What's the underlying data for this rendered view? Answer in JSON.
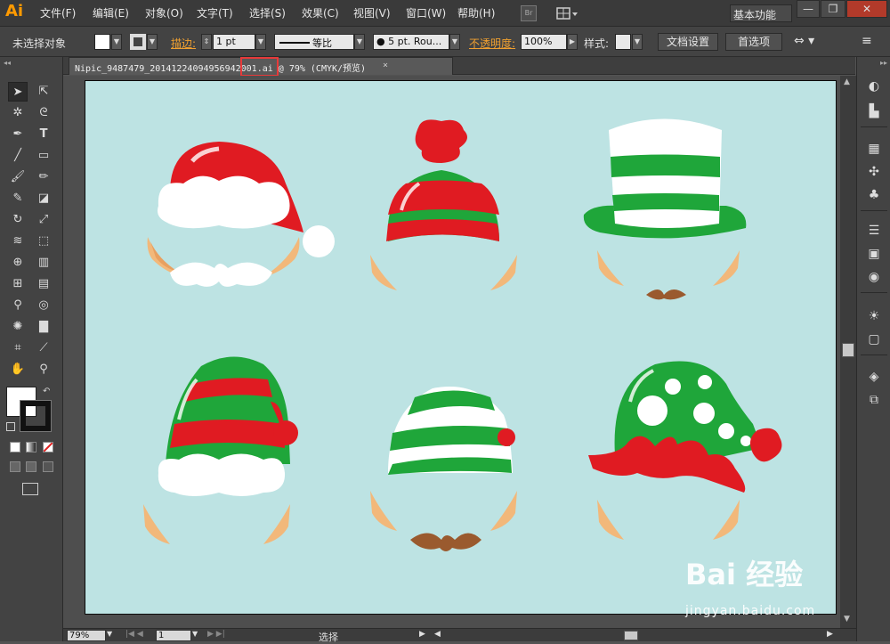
{
  "app": {
    "logo": "Ai",
    "menu": [
      "文件(F)",
      "编辑(E)",
      "对象(O)",
      "文字(T)",
      "选择(S)",
      "效果(C)",
      "视图(V)",
      "窗口(W)",
      "帮助(H)"
    ],
    "bridge_label": "Br",
    "workspace": "基本功能",
    "window_buttons": [
      "—",
      "❐",
      "✕"
    ]
  },
  "control": {
    "selection_state": "未选择对象",
    "stroke_label": "描边:",
    "stroke_weight": "1 pt",
    "brush_profile": "等比",
    "brush_def": "● 5 pt. Rou...",
    "opacity_label": "不透明度:",
    "opacity_value": "100%",
    "style_label": "样式:",
    "doc_setup_button": "文档设置",
    "preferences_button": "首选项"
  },
  "document": {
    "tab_title": "Nipic_9487479_20141224094956942001.ai @ 79% (CMYK/预览)",
    "tab_close": "×"
  },
  "status": {
    "zoom": "79%",
    "page": "1",
    "tool_status": "选择"
  },
  "watermark": {
    "brand": "Bai 经验",
    "url": "jingyan.baidu.com"
  },
  "colors": {
    "accent_orange": "#f0a030",
    "artboard": "#bde3e3",
    "red": "#e01b22",
    "green": "#1fa63a",
    "ear": "#f2b87a",
    "mustache": "#9a5a2e"
  },
  "icons": {
    "tools": [
      "selection-icon",
      "direct-selection-icon",
      "magic-wand-icon",
      "lasso-icon",
      "pen-icon",
      "type-icon",
      "line-icon",
      "rectangle-icon",
      "paintbrush-icon",
      "pencil-icon",
      "blob-brush-icon",
      "eraser-icon",
      "rotate-icon",
      "scale-icon",
      "warp-icon",
      "free-transform-icon",
      "shape-builder-icon",
      "perspective-grid-icon",
      "mesh-icon",
      "gradient-icon",
      "eyedropper-icon",
      "blend-icon",
      "symbol-sprayer-icon",
      "column-graph-icon",
      "artboard-icon",
      "slice-icon",
      "hand-icon",
      "zoom-icon"
    ]
  }
}
